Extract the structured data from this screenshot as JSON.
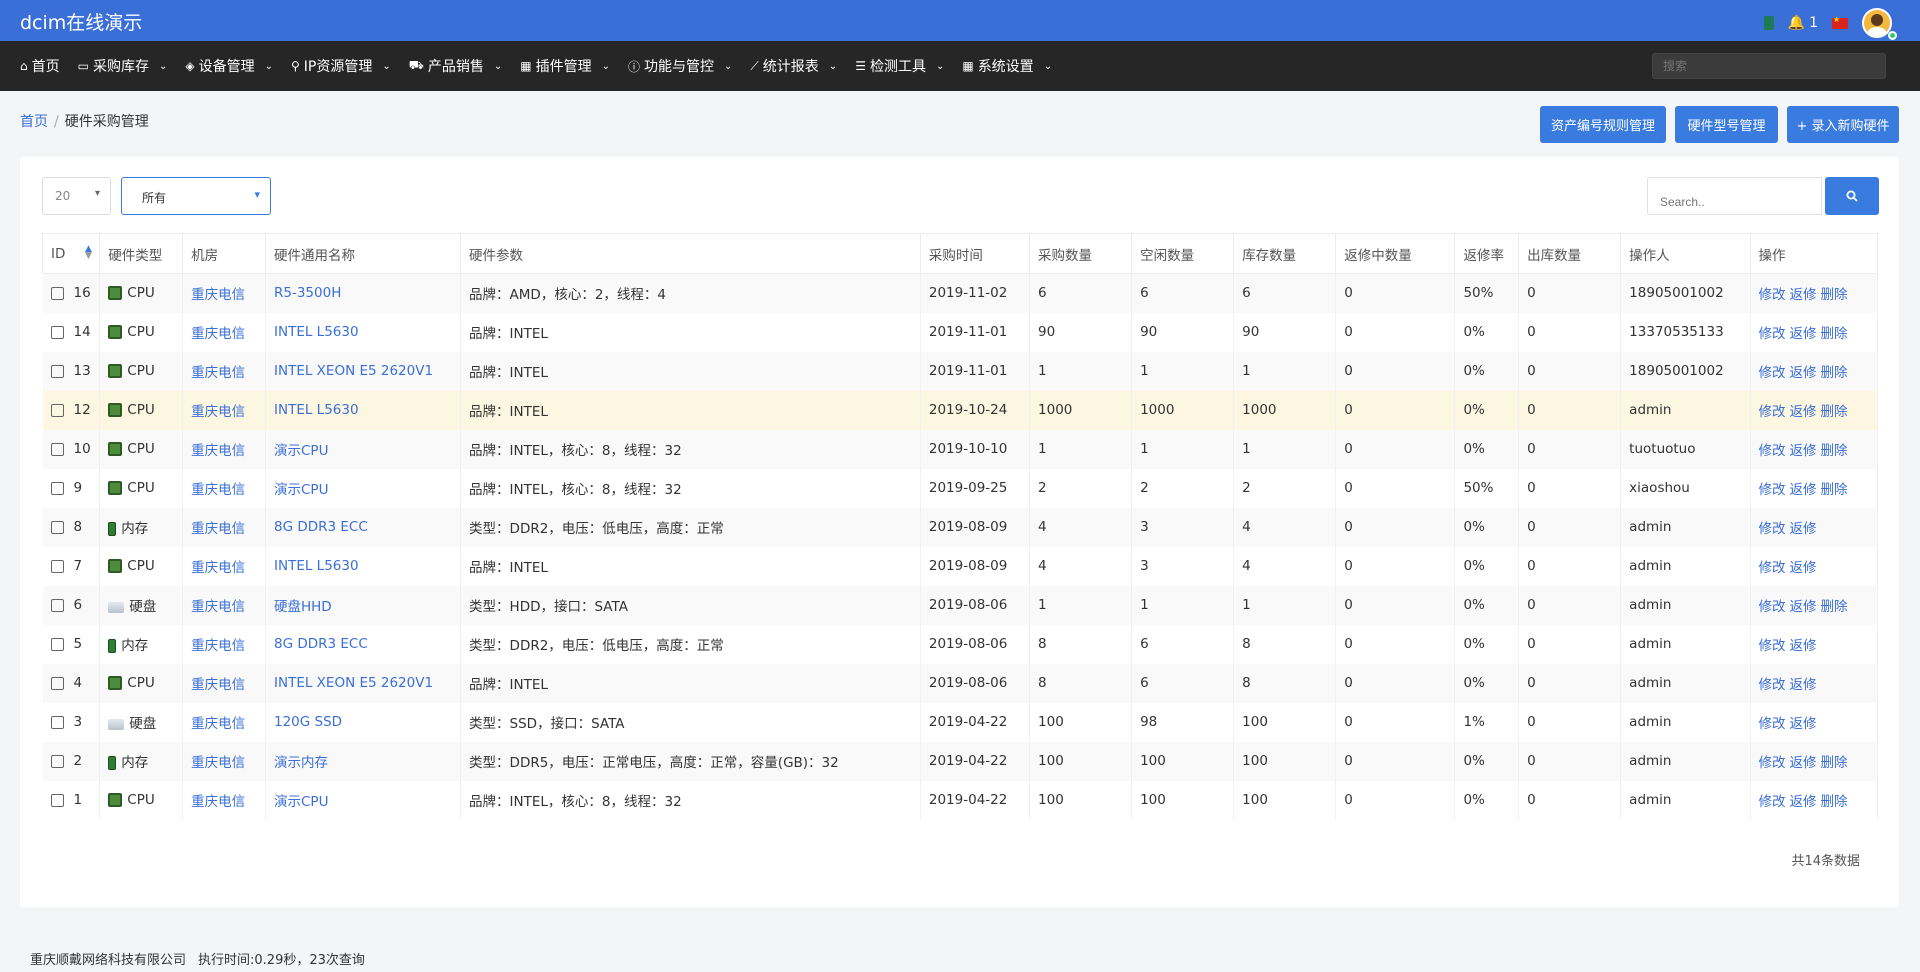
{
  "header": {
    "brand": "dcim在线演示",
    "notif_count": "1"
  },
  "nav": {
    "items": [
      "首页",
      "采购库存",
      "设备管理",
      "IP资源管理",
      "产品销售",
      "插件管理",
      "功能与管控",
      "统计报表",
      "检测工具",
      "系统设置"
    ],
    "icons": [
      "home-icon",
      "drive-icon",
      "cube-icon",
      "map-marker-icon",
      "cart-icon",
      "grid-icon",
      "info-circle-icon",
      "line-chart-icon",
      "list-icon",
      "grid-icon"
    ],
    "search_placeholder": "搜索"
  },
  "breadcrumb": {
    "home": "首页",
    "current": "硬件采购管理"
  },
  "toolbar": {
    "btn_asset_rules": "资产编号规则管理",
    "btn_model_mgmt": "硬件型号管理",
    "btn_add_new": "+ 录入新购硬件"
  },
  "filters": {
    "page_size": "20",
    "status": "所有",
    "search_placeholder": "Search.."
  },
  "table": {
    "columns": [
      "ID",
      "硬件类型",
      "机房",
      "硬件通用名称",
      "硬件参数",
      "采购时间",
      "采购数量",
      "空闲数量",
      "库存数量",
      "返修中数量",
      "返修率",
      "出库数量",
      "操作人",
      "操作"
    ],
    "rows": [
      {
        "id": "16",
        "type": "CPU",
        "room": "重庆电信",
        "name": "R5-3500H",
        "params": "品牌：AMD，核心：2，线程：4",
        "date": "2019-11-02",
        "purchased": "6",
        "idle": "6",
        "stock": "6",
        "repairing": "0",
        "repair_rate": "50%",
        "out": "0",
        "operator": "18905001002",
        "actions": [
          "修改",
          "返修",
          "删除"
        ]
      },
      {
        "id": "14",
        "type": "CPU",
        "room": "重庆电信",
        "name": "INTEL L5630",
        "params": "品牌：INTEL",
        "date": "2019-11-01",
        "purchased": "90",
        "idle": "90",
        "stock": "90",
        "repairing": "0",
        "repair_rate": "0%",
        "out": "0",
        "operator": "13370535133",
        "actions": [
          "修改",
          "返修",
          "删除"
        ]
      },
      {
        "id": "13",
        "type": "CPU",
        "room": "重庆电信",
        "name": "INTEL XEON E5 2620V1",
        "params": "品牌：INTEL",
        "date": "2019-11-01",
        "purchased": "1",
        "idle": "1",
        "stock": "1",
        "repairing": "0",
        "repair_rate": "0%",
        "out": "0",
        "operator": "18905001002",
        "actions": [
          "修改",
          "返修",
          "删除"
        ]
      },
      {
        "id": "12",
        "type": "CPU",
        "room": "重庆电信",
        "name": "INTEL L5630",
        "params": "品牌：INTEL",
        "date": "2019-10-24",
        "purchased": "1000",
        "idle": "1000",
        "stock": "1000",
        "repairing": "0",
        "repair_rate": "0%",
        "out": "0",
        "operator": "admin",
        "actions": [
          "修改",
          "返修",
          "删除"
        ]
      },
      {
        "id": "10",
        "type": "CPU",
        "room": "重庆电信",
        "name": "演示CPU",
        "params": "品牌：INTEL，核心：8，线程：32",
        "date": "2019-10-10",
        "purchased": "1",
        "idle": "1",
        "stock": "1",
        "repairing": "0",
        "repair_rate": "0%",
        "out": "0",
        "operator": "tuotuotuo",
        "actions": [
          "修改",
          "返修",
          "删除"
        ]
      },
      {
        "id": "9",
        "type": "CPU",
        "room": "重庆电信",
        "name": "演示CPU",
        "params": "品牌：INTEL，核心：8，线程：32",
        "date": "2019-09-25",
        "purchased": "2",
        "idle": "2",
        "stock": "2",
        "repairing": "0",
        "repair_rate": "50%",
        "out": "0",
        "operator": "xiaoshou",
        "actions": [
          "修改",
          "返修",
          "删除"
        ]
      },
      {
        "id": "8",
        "type": "内存",
        "room": "重庆电信",
        "name": "8G DDR3 ECC",
        "params": "类型：DDR2，电压：低电压，高度：正常",
        "date": "2019-08-09",
        "purchased": "4",
        "idle": "3",
        "stock": "4",
        "repairing": "0",
        "repair_rate": "0%",
        "out": "0",
        "operator": "admin",
        "actions": [
          "修改",
          "返修"
        ]
      },
      {
        "id": "7",
        "type": "CPU",
        "room": "重庆电信",
        "name": "INTEL L5630",
        "params": "品牌：INTEL",
        "date": "2019-08-09",
        "purchased": "4",
        "idle": "3",
        "stock": "4",
        "repairing": "0",
        "repair_rate": "0%",
        "out": "0",
        "operator": "admin",
        "actions": [
          "修改",
          "返修"
        ]
      },
      {
        "id": "6",
        "type": "硬盘",
        "room": "重庆电信",
        "name": "硬盘HHD",
        "params": "类型：HDD，接口：SATA",
        "date": "2019-08-06",
        "purchased": "1",
        "idle": "1",
        "stock": "1",
        "repairing": "0",
        "repair_rate": "0%",
        "out": "0",
        "operator": "admin",
        "actions": [
          "修改",
          "返修",
          "删除"
        ]
      },
      {
        "id": "5",
        "type": "内存",
        "room": "重庆电信",
        "name": "8G DDR3 ECC",
        "params": "类型：DDR2，电压：低电压，高度：正常",
        "date": "2019-08-06",
        "purchased": "8",
        "idle": "6",
        "stock": "8",
        "repairing": "0",
        "repair_rate": "0%",
        "out": "0",
        "operator": "admin",
        "actions": [
          "修改",
          "返修"
        ]
      },
      {
        "id": "4",
        "type": "CPU",
        "room": "重庆电信",
        "name": "INTEL XEON E5 2620V1",
        "params": "品牌：INTEL",
        "date": "2019-08-06",
        "purchased": "8",
        "idle": "6",
        "stock": "8",
        "repairing": "0",
        "repair_rate": "0%",
        "out": "0",
        "operator": "admin",
        "actions": [
          "修改",
          "返修"
        ]
      },
      {
        "id": "3",
        "type": "硬盘",
        "room": "重庆电信",
        "name": "120G SSD",
        "params": "类型：SSD，接口：SATA",
        "date": "2019-04-22",
        "purchased": "100",
        "idle": "98",
        "stock": "100",
        "repairing": "0",
        "repair_rate": "1%",
        "out": "0",
        "operator": "admin",
        "actions": [
          "修改",
          "返修"
        ]
      },
      {
        "id": "2",
        "type": "内存",
        "room": "重庆电信",
        "name": "演示内存",
        "params": "类型：DDR5，电压：正常电压，高度：正常，容量(GB)：32",
        "date": "2019-04-22",
        "purchased": "100",
        "idle": "100",
        "stock": "100",
        "repairing": "0",
        "repair_rate": "0%",
        "out": "0",
        "operator": "admin",
        "actions": [
          "修改",
          "返修",
          "删除"
        ]
      },
      {
        "id": "1",
        "type": "CPU",
        "room": "重庆电信",
        "name": "演示CPU",
        "params": "品牌：INTEL，核心：8，线程：32",
        "date": "2019-04-22",
        "purchased": "100",
        "idle": "100",
        "stock": "100",
        "repairing": "0",
        "repair_rate": "0%",
        "out": "0",
        "operator": "admin",
        "actions": [
          "修改",
          "返修",
          "删除"
        ]
      }
    ],
    "total": "共14条数据"
  },
  "footer": {
    "company": "重庆顺戴网络科技有限公司",
    "exec": "执行时间:0.29秒，23次查询"
  }
}
